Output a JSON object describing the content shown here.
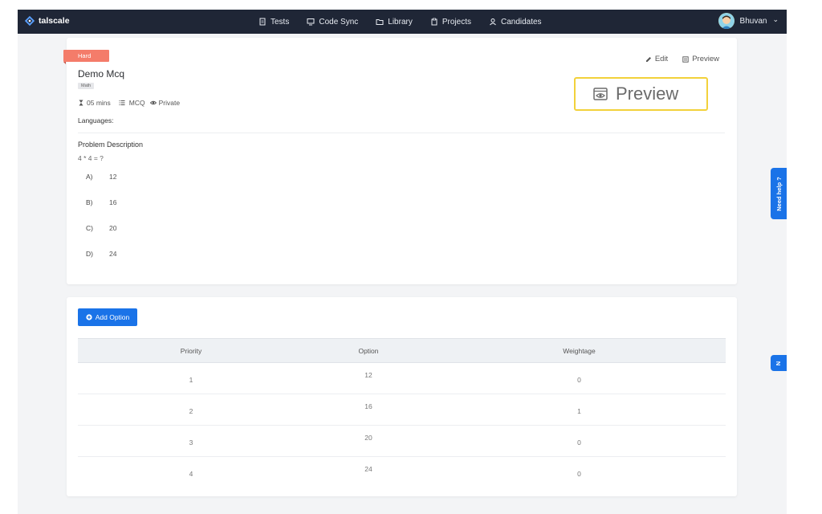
{
  "nav": {
    "brand": "talscale",
    "items": [
      {
        "label": "Tests",
        "icon": "document-icon"
      },
      {
        "label": "Code Sync",
        "icon": "monitor-icon"
      },
      {
        "label": "Library",
        "icon": "folder-icon"
      },
      {
        "label": "Projects",
        "icon": "clipboard-icon"
      },
      {
        "label": "Candidates",
        "icon": "user-icon"
      }
    ],
    "user": "Bhuvan",
    "user_caret": "⌄"
  },
  "problem": {
    "difficulty": "Hard",
    "title": "Demo Mcq",
    "tag": "Math",
    "duration": "05 mins",
    "type": "MCQ",
    "visibility": "Private",
    "languages_label": "Languages:",
    "description_title": "Problem Description",
    "question": "4 * 4 = ?",
    "options": [
      {
        "key": "A)",
        "value": "12"
      },
      {
        "key": "B)",
        "value": "16"
      },
      {
        "key": "C)",
        "value": "20"
      },
      {
        "key": "D)",
        "value": "24"
      }
    ]
  },
  "actions": {
    "edit": "Edit",
    "preview": "Preview",
    "preview_callout": "Preview"
  },
  "help": {
    "label": "Need help ?",
    "label_short": "N"
  },
  "options_table": {
    "add_label": "Add Option",
    "headers": [
      "Priority",
      "Option",
      "Weightage"
    ],
    "rows": [
      {
        "priority": "1",
        "option": "12",
        "weightage": "0"
      },
      {
        "priority": "2",
        "option": "16",
        "weightage": "1"
      },
      {
        "priority": "3",
        "option": "20",
        "weightage": "0"
      },
      {
        "priority": "4",
        "option": "24",
        "weightage": "0"
      }
    ]
  },
  "colors": {
    "navbar": "#1f2636",
    "accent": "#1a73e8",
    "hard_badge": "#f47c6a",
    "callout_border": "#f2d13b"
  }
}
